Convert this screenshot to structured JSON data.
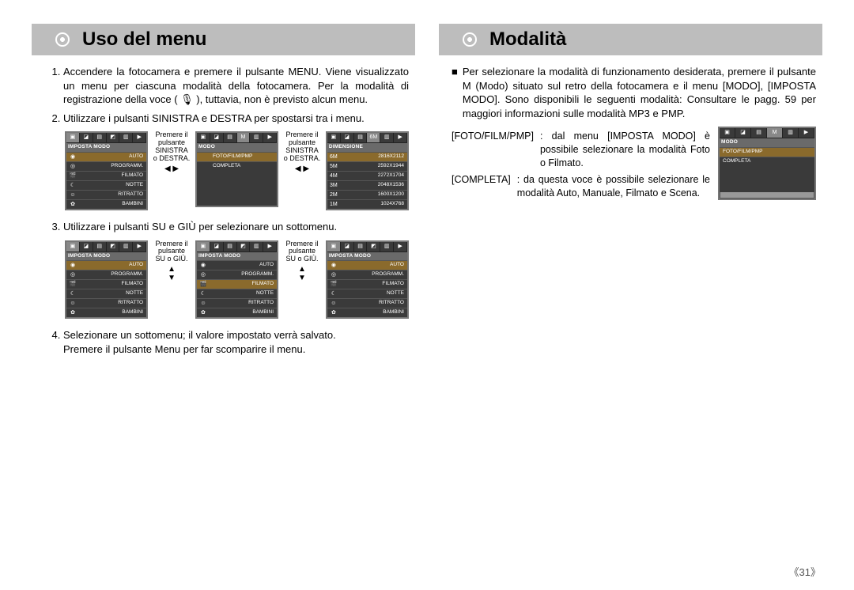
{
  "page_number": "《31》",
  "left": {
    "title": "Uso del menu",
    "steps": {
      "s1": "Accendere la fotocamera e premere il pulsante MENU. Viene visualizzato un menu per ciascuna modalità della fotocamera. Per la modalità di registrazione della voce ( 🎙 ), tuttavia, non è previsto alcun menu.",
      "s2": "Utilizzare i pulsanti SINISTRA e DESTRA per spostarsi tra i menu.",
      "s3": "Utilizzare i pulsanti SU e GIÙ per selezionare un sottomenu.",
      "s4a": "Selezionare un sottomenu; il valore impostato verrà salvato.",
      "s4b": "Premere il pulsante Menu per far scomparire il menu."
    },
    "hint_lr": "Premere il pulsante SINISTRA o DESTRA.",
    "hint_ud": "Premere il pulsante SU o GIÙ.",
    "lcd_imposta": {
      "header": "IMPOSTA MODO",
      "rows": [
        "AUTO",
        "PROGRAMM.",
        "FILMATO",
        "NOTTE",
        "RITRATTO",
        "BAMBINI"
      ]
    },
    "lcd_modo": {
      "header": "MODO",
      "rows": [
        "FOTO/FILM/PMP",
        "COMPLETA"
      ]
    },
    "lcd_dim": {
      "header": "DIMENSIONE",
      "rows": [
        "2816X2112",
        "2592X1944",
        "2272X1704",
        "2048X1536",
        "1600X1200",
        "1024X768"
      ],
      "mp": [
        "6M",
        "5M",
        "4M",
        "3M",
        "2M",
        "1M"
      ]
    }
  },
  "right": {
    "title": "Modalità",
    "intro": "Per selezionare la modalità di funzionamento desiderata, premere il pulsante M (Modo) situato sul retro della fotocamera e il menu [MODO], [IMPOSTA MODO]. Sono disponibili le seguenti modalità: Consultare le pagg. 59 per maggiori informazioni sulle modalità MP3 e PMP.",
    "def1_key": "[FOTO/FILM/PMP]",
    "def1_val": ": dal menu [IMPOSTA MODO] è possibile selezionare la modalità Foto o Filmato.",
    "def2_key": "[COMPLETA]",
    "def2_val": ": da questa voce è possibile selezionare le modalità Auto, Manuale, Filmato e Scena.",
    "lcd_modo": {
      "header": "MODO",
      "rows": [
        "FOTO/FILM/PMP",
        "COMPLETA"
      ]
    }
  }
}
